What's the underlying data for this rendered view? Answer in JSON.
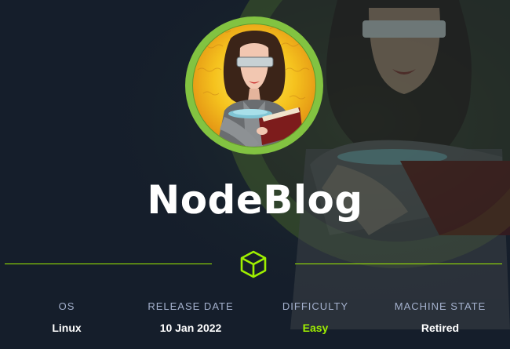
{
  "machine": {
    "name": "NodeBlog"
  },
  "stats": [
    {
      "label": "OS",
      "value": "Linux"
    },
    {
      "label": "RELEASE DATE",
      "value": "10 Jan 2022"
    },
    {
      "label": "DIFFICULTY",
      "value": "Easy"
    },
    {
      "label": "MACHINE STATE",
      "value": "Retired"
    }
  ],
  "colors": {
    "background": "#151e2b",
    "accent": "#9fef00",
    "label": "#a4b1cd",
    "avatar_ring": "#82c341"
  },
  "icons": {
    "avatar": "machine-avatar-woman-reading-icon",
    "divider": "cube-icon"
  }
}
